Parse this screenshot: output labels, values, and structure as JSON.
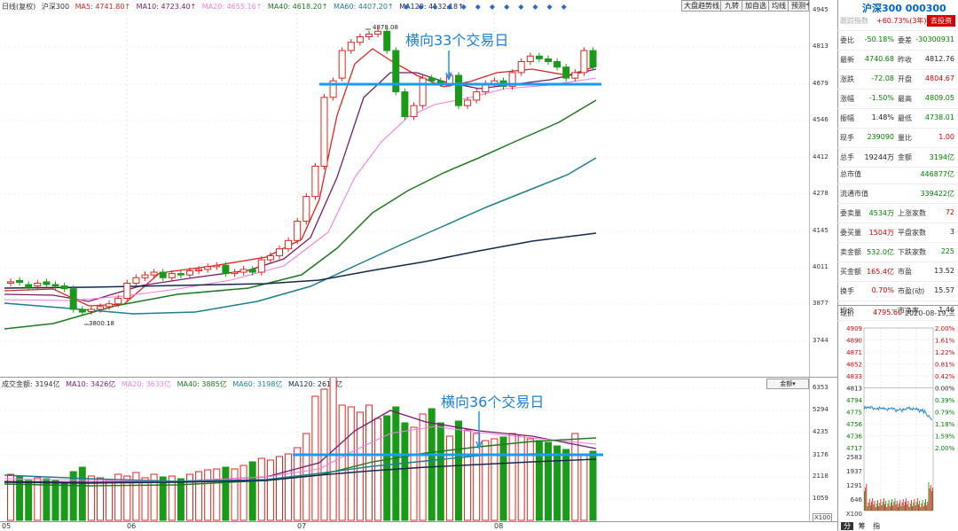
{
  "main_legend": {
    "period": "日线(复权)",
    "index": "沪深300",
    "ma5": "MA5: 4741.80↑",
    "ma10": "MA10: 4723.40↑",
    "ma20": "MA20: 4655.16↑",
    "ma40": "MA40: 4618.20↑",
    "ma60": "MA60: 4407.20↑",
    "ma120": "MA120: 4132.18↑"
  },
  "vol_legend": {
    "label": "成交金额: 3194亿",
    "ma10": "MA10: 3426亿",
    "ma20": "MA20: 3633亿",
    "ma40": "MA40: 3885亿",
    "ma60": "MA60: 3198亿",
    "ma120": "MA120: 2614亿"
  },
  "toolbar": [
    "大盘趋势线",
    "九转",
    "加自选",
    "均线",
    "预测"
  ],
  "vol_selector": "金额",
  "main_yaxis": [
    "4945",
    "4813",
    "4679",
    "4546",
    "4412",
    "4278",
    "4145",
    "4011",
    "3877",
    "3744"
  ],
  "vol_yaxis": [
    "6353",
    "5294",
    "4235",
    "3176",
    "2118",
    "1059",
    "X100"
  ],
  "xaxis": [
    "05",
    "06",
    "07",
    "08"
  ],
  "annotations": {
    "high": "4878.08",
    "low": "3800.18",
    "span1": "横向33个交易日",
    "span2": "横向36个交易日"
  },
  "panel": {
    "title": "沪深300 000300",
    "track_label": "跟踪指数",
    "track_value": "+60.73%(3年)",
    "track_button": "去投资",
    "rows": [
      {
        "l1": "委比",
        "v1": "-50.18%",
        "l2": "委差",
        "v2": "-30300931",
        "c1": "green",
        "c2": "green"
      },
      {
        "l1": "最新",
        "v1": "4740.68",
        "l2": "昨收",
        "v2": "4812.76",
        "c1": "green",
        "c2": "dark"
      },
      {
        "l1": "涨跌",
        "v1": "-72.08",
        "l2": "开盘",
        "v2": "4804.67",
        "c1": "green",
        "c2": "red"
      },
      {
        "l1": "涨幅",
        "v1": "-1.50%",
        "l2": "最高",
        "v2": "4809.05",
        "c1": "green",
        "c2": "green"
      },
      {
        "l1": "振幅",
        "v1": "1.48%",
        "l2": "最低",
        "v2": "4738.01",
        "c1": "dark",
        "c2": "green"
      },
      {
        "l1": "现手",
        "v1": "239090",
        "l2": "量比",
        "v2": "1.00",
        "c1": "green",
        "c2": "red"
      },
      {
        "l1": "总手",
        "v1": "19244万",
        "l2": "金额",
        "v2": "3194亿",
        "c1": "dark",
        "c2": "green"
      }
    ],
    "mcap_label": "总市值",
    "mcap_value": "446877亿",
    "float_label": "流通市值",
    "float_value": "339422亿",
    "rows2": [
      {
        "l1": "委卖量",
        "v1": "4534万",
        "l2": "上涨家数",
        "v2": "72",
        "c1": "green",
        "c2": "red"
      },
      {
        "l1": "委买量",
        "v1": "1504万",
        "l2": "平盘家数",
        "v2": "3",
        "c1": "red",
        "c2": "dark"
      },
      {
        "l1": "卖金额",
        "v1": "532.0亿",
        "l2": "下跌家数",
        "v2": "225",
        "c1": "green",
        "c2": "green"
      },
      {
        "l1": "买金额",
        "v1": "165.4亿",
        "l2": "市盈",
        "v2": "13.52",
        "c1": "red",
        "c2": "dark"
      },
      {
        "l1": "换手",
        "v1": "0.70%",
        "l2": "市盈(动)",
        "v2": "15.57",
        "c1": "red",
        "c2": "dark"
      },
      {
        "l1": "均价",
        "v1": "-",
        "l2": "市净率",
        "v2": "1.46",
        "c1": "dark",
        "c2": "dark"
      }
    ],
    "now_label": "现价",
    "now_value": "4795.60",
    "now_date": "2020-08-19,三",
    "mini_left": [
      "4909",
      "4890",
      "4871",
      "4852",
      "4833",
      "4813",
      "4794",
      "4775",
      "4756",
      "4736",
      "4717"
    ],
    "mini_right": [
      "2.00%",
      "1.61%",
      "1.22%",
      "0.81%",
      "0.42%",
      "0.00%",
      "0.39%",
      "0.79%",
      "1.18%",
      "1.59%",
      "2.00%"
    ],
    "mini_vol": [
      "2583",
      "1937",
      "1291",
      "646",
      "X100"
    ],
    "bottom_tabs": [
      "分",
      "筹",
      "指"
    ]
  },
  "colors": {
    "up": "#e0241f",
    "down": "#199b19",
    "ma5": "#e0241f",
    "ma10": "#7b1a6b",
    "ma20": "#f37de8",
    "ma40": "#1e7a1e",
    "ma60": "#1a7f8f",
    "ma120": "#142a4a",
    "annot": "#1a9bf0"
  }
}
